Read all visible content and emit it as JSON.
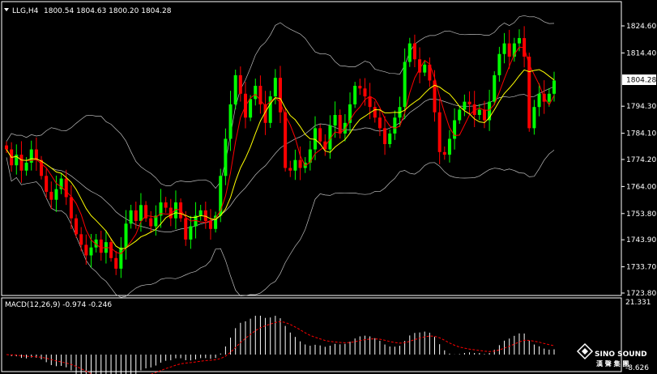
{
  "colors": {
    "background": "#000000",
    "bull": "#00ff00",
    "bear": "#ff0000",
    "bollinger": "#bdbdbd",
    "ma_fast": "#ff0000",
    "ma_slow": "#ffff00",
    "macd_hist": "#ffffff",
    "macd_signal": "#ff0000",
    "axis": "#ffffff",
    "current_price_box": "#ffffff"
  },
  "header": {
    "symbol_label": "LLG,H4",
    "ohlc_text": "1800.54 1804.63 1800.20 1804.28",
    "triangle_icon": "triangle-down-icon"
  },
  "current_price_label": "1804.28",
  "price_ticks": [
    "1824.60",
    "1814.40",
    "1804.28",
    "1794.30",
    "1784.10",
    "1774.20",
    "1764.00",
    "1753.80",
    "1743.90",
    "1733.70",
    "1723.80"
  ],
  "macd_header": "MACD(12,26,9) -0.974 -0.246",
  "macd_ticks": [
    "21.331",
    "-8.626"
  ],
  "logo": {
    "name": "SINO SOUND",
    "chinese": "漢 聲 集 團"
  },
  "chart_data": [
    {
      "type": "candlestick",
      "title": "LLG,H4",
      "indicators": [
        "Bollinger Bands",
        "Moving Average (fast)",
        "Moving Average (slow)"
      ],
      "ylim": [
        1723.8,
        1824.6
      ],
      "last_close": 1804.28,
      "grid": false,
      "closes": [
        1778,
        1772,
        1776,
        1770,
        1773,
        1778,
        1774,
        1768,
        1762,
        1759,
        1763,
        1767,
        1760,
        1752,
        1746,
        1742,
        1738,
        1741,
        1744,
        1739,
        1743,
        1737,
        1733,
        1741,
        1750,
        1755,
        1751,
        1757,
        1752,
        1749,
        1753,
        1758,
        1756,
        1752,
        1758,
        1752,
        1744,
        1749,
        1753,
        1755,
        1751,
        1748,
        1753,
        1768,
        1782,
        1795,
        1806,
        1799,
        1790,
        1797,
        1802,
        1795,
        1788,
        1798,
        1805,
        1792,
        1771,
        1770,
        1774,
        1771,
        1773,
        1778,
        1786,
        1781,
        1778,
        1787,
        1791,
        1784,
        1788,
        1795,
        1802,
        1801,
        1798,
        1794,
        1790,
        1786,
        1780,
        1784,
        1790,
        1794,
        1811,
        1818,
        1812,
        1807,
        1810,
        1804,
        1792,
        1777,
        1776,
        1782,
        1789,
        1793,
        1796,
        1795,
        1791,
        1793,
        1789,
        1796,
        1806,
        1814,
        1818,
        1813,
        1818,
        1820,
        1813,
        1786,
        1794,
        1799,
        1796,
        1799,
        1804
      ]
    },
    {
      "type": "bar",
      "title": "MACD(12,26,9)",
      "series": [
        {
          "name": "MACD",
          "current": -0.974
        },
        {
          "name": "Signal",
          "current": -0.246
        }
      ],
      "ylim": [
        -8.626,
        21.331
      ]
    }
  ]
}
